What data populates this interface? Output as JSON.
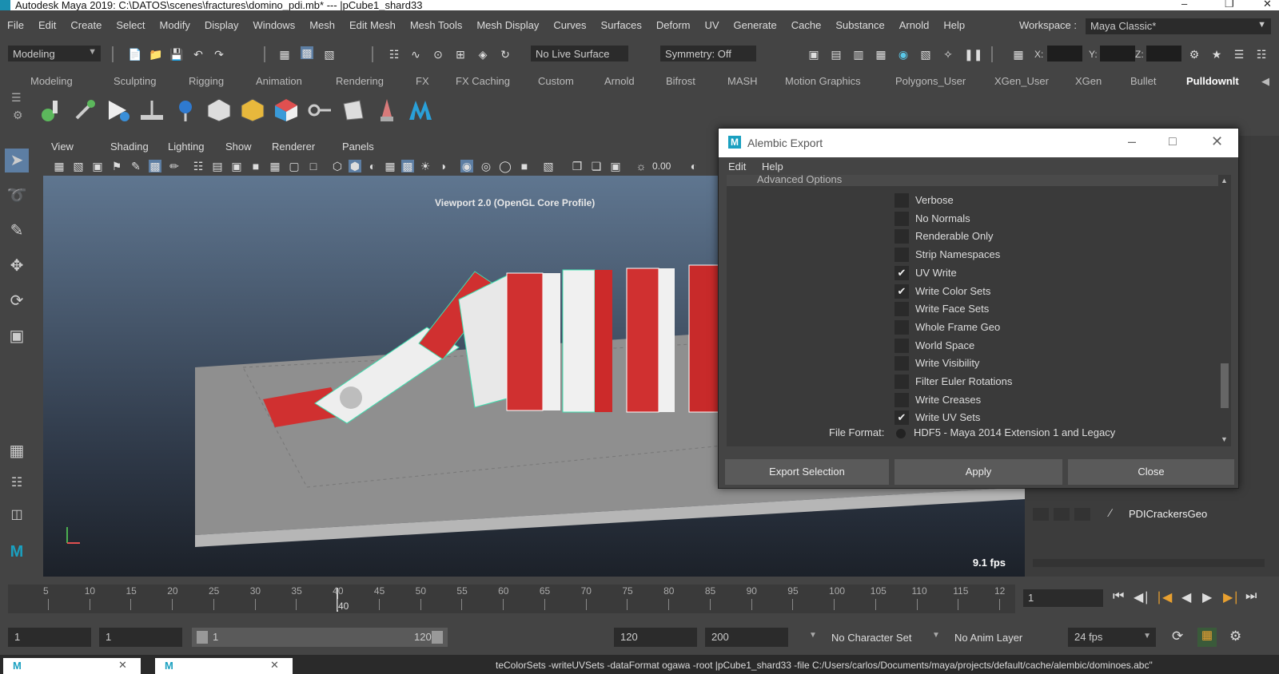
{
  "window": {
    "title": "Autodesk Maya 2019: C:\\DATOS\\scenes\\fractures\\domino_pdi.mb*   ---   |pCube1_shard33"
  },
  "menubar": [
    "File",
    "Edit",
    "Create",
    "Select",
    "Modify",
    "Display",
    "Windows",
    "Mesh",
    "Edit Mesh",
    "Mesh Tools",
    "Mesh Display",
    "Curves",
    "Surfaces",
    "Deform",
    "UV",
    "Generate",
    "Cache",
    "Substance",
    "Arnold",
    "Help"
  ],
  "workspace": {
    "label": "Workspace :",
    "value": "Maya Classic*"
  },
  "statusline": {
    "mode": "Modeling",
    "live_surface": "No Live Surface",
    "symmetry": "Symmetry: Off",
    "x_label": "X:",
    "y_label": "Y:",
    "z_label": "Z:"
  },
  "shelf_tabs": [
    "Modeling",
    "Sculpting",
    "Rigging",
    "Animation",
    "Rendering",
    "FX",
    "FX Caching",
    "Custom",
    "Arnold",
    "Bifrost",
    "MASH",
    "Motion Graphics",
    "Polygons_User",
    "XGen_User",
    "XGen",
    "Bullet",
    "Pulldownlt"
  ],
  "panel_menu": [
    "View",
    "Shading",
    "Lighting",
    "Show",
    "Renderer",
    "Panels"
  ],
  "panel_toolbar": {
    "exposure_value": "0.00"
  },
  "viewport": {
    "label": "Viewport 2.0 (OpenGL Core Profile)",
    "fps": "9.1 fps"
  },
  "outliner": {
    "item": "PDICrackersGeo"
  },
  "dialog": {
    "title": "Alembic Export",
    "menu": [
      "Edit",
      "Help"
    ],
    "section": "Advanced Options",
    "options": [
      {
        "label": "Verbose",
        "checked": false
      },
      {
        "label": "No Normals",
        "checked": false
      },
      {
        "label": "Renderable Only",
        "checked": false
      },
      {
        "label": "Strip Namespaces",
        "checked": false
      },
      {
        "label": "UV Write",
        "checked": true
      },
      {
        "label": "Write Color Sets",
        "checked": true
      },
      {
        "label": "Write Face Sets",
        "checked": false
      },
      {
        "label": "Whole Frame Geo",
        "checked": false
      },
      {
        "label": "World Space",
        "checked": false
      },
      {
        "label": "Write Visibility",
        "checked": false
      },
      {
        "label": "Filter Euler Rotations",
        "checked": false
      },
      {
        "label": "Write Creases",
        "checked": false
      },
      {
        "label": "Write UV Sets",
        "checked": true
      }
    ],
    "file_format_label": "File Format:",
    "file_format_value": "HDF5 - Maya 2014 Extension 1 and Legacy",
    "buttons": {
      "export_selection": "Export Selection",
      "apply": "Apply",
      "close": "Close"
    }
  },
  "timeslider": {
    "ticks": [
      "5",
      "10",
      "15",
      "20",
      "25",
      "30",
      "35",
      "40",
      "45",
      "50",
      "55",
      "60",
      "65",
      "70",
      "75",
      "80",
      "85",
      "90",
      "95",
      "100",
      "105",
      "110",
      "115",
      "12"
    ],
    "current_marker": "40",
    "current_frame": "1"
  },
  "range": {
    "start": "1",
    "playback_start": "1",
    "slider_start": "1",
    "slider_end": "120",
    "playback_end": "120",
    "end": "200",
    "character_set": "No Character Set",
    "anim_layer": "No Anim Layer",
    "fps": "24 fps"
  },
  "command_line": "teColorSets -writeUVSets -dataFormat ogawa -root |pCube1_shard33 -file C:/Users/carlos/Documents/maya/projects/default/cache/alembic/dominoes.abc\""
}
